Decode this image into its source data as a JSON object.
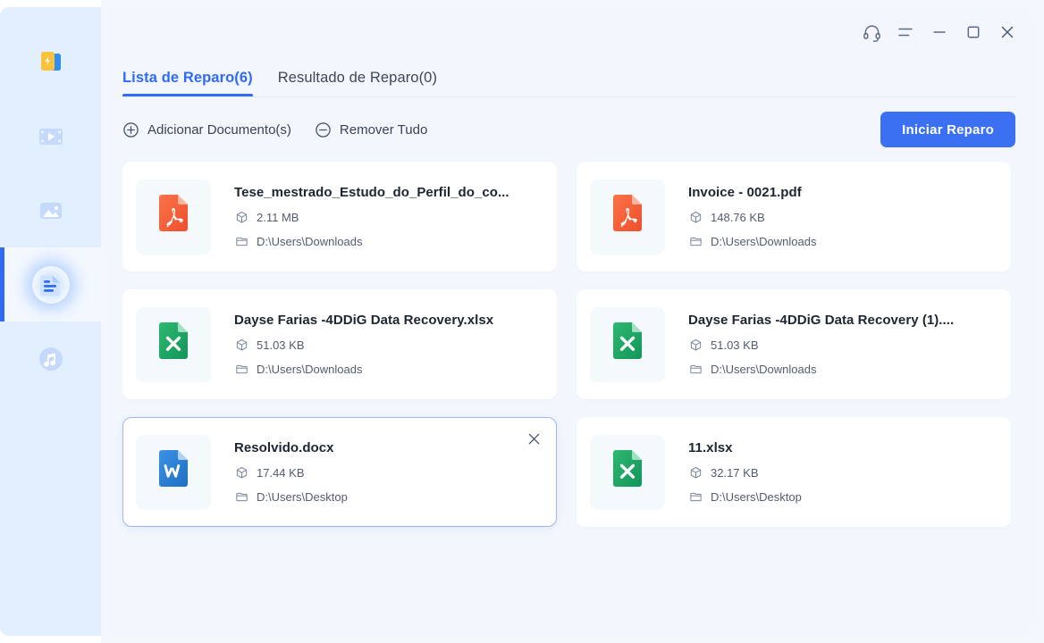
{
  "sidebar": {
    "items": [
      {
        "id": "file-repair",
        "icon": "file-repair-icon",
        "active": false
      },
      {
        "id": "video-repair",
        "icon": "video-film-icon",
        "active": false
      },
      {
        "id": "photo-repair",
        "icon": "photo-image-icon",
        "active": false
      },
      {
        "id": "document-repair",
        "icon": "document-lines-icon",
        "active": true
      },
      {
        "id": "audio-repair",
        "icon": "music-note-icon",
        "active": false
      }
    ]
  },
  "titlebar": {
    "buttons": [
      {
        "id": "support",
        "icon": "headphones-icon"
      },
      {
        "id": "menu",
        "icon": "hamburger-menu-icon"
      },
      {
        "id": "minimize",
        "icon": "minimize-icon"
      },
      {
        "id": "maximize",
        "icon": "maximize-icon"
      },
      {
        "id": "close",
        "icon": "close-icon"
      }
    ]
  },
  "tabs": [
    {
      "label": "Lista de Reparo(6)",
      "active": true
    },
    {
      "label": "Resultado de Reparo(0)",
      "active": false
    }
  ],
  "toolbar": {
    "add_label": "Adicionar Documento(s)",
    "add_icon": "plus-circle-icon",
    "remove_label": "Remover Tudo",
    "remove_icon": "minus-circle-icon",
    "start_label": "Iniciar Reparo"
  },
  "colors": {
    "accent": "#2f6bf5",
    "primary_button": "#3b70f2",
    "sidebar_bg": "#e1efff",
    "content_bg": "#f3f7fd",
    "card_bg": "#ffffff",
    "pdf_icon": "#f4603a",
    "excel_icon": "#21a365",
    "word_icon": "#2b7cd3",
    "selected_border": "#9cb6f7"
  },
  "files": [
    {
      "name": "Tese_mestrado_Estudo_do_Perfil_do_co...",
      "size": "2.11 MB",
      "path": "D:\\Users\\Downloads",
      "type": "pdf",
      "selected": false
    },
    {
      "name": "Invoice - 0021.pdf",
      "size": "148.76 KB",
      "path": "D:\\Users\\Downloads",
      "type": "pdf",
      "selected": false
    },
    {
      "name": "Dayse Farias -4DDiG Data Recovery.xlsx",
      "size": "51.03 KB",
      "path": "D:\\Users\\Downloads",
      "type": "xlsx",
      "selected": false
    },
    {
      "name": "Dayse Farias -4DDiG Data Recovery (1)....",
      "size": "51.03 KB",
      "path": "D:\\Users\\Downloads",
      "type": "xlsx",
      "selected": false
    },
    {
      "name": "Resolvido.docx",
      "size": "17.44 KB",
      "path": "D:\\Users\\Desktop",
      "type": "docx",
      "selected": true
    },
    {
      "name": "11.xlsx",
      "size": "32.17 KB",
      "path": "D:\\Users\\Desktop",
      "type": "xlsx",
      "selected": false
    }
  ]
}
